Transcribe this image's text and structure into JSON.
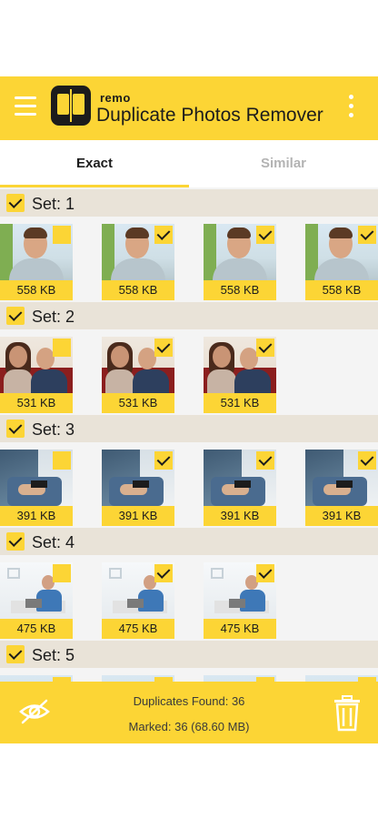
{
  "header": {
    "brand_sub": "remo",
    "title": "Duplicate Photos Remover",
    "colors": {
      "accent": "#fcd535",
      "dark": "#1c1c1c"
    }
  },
  "tabs": [
    {
      "label": "Exact",
      "active": true
    },
    {
      "label": "Similar",
      "active": false
    }
  ],
  "sets": [
    {
      "label": "Set: 1",
      "checked": true,
      "photo": "man-portrait",
      "items": [
        {
          "size": "558 KB",
          "checked": false
        },
        {
          "size": "558 KB",
          "checked": true
        },
        {
          "size": "558 KB",
          "checked": true
        },
        {
          "size": "558 KB",
          "checked": true
        }
      ]
    },
    {
      "label": "Set: 2",
      "checked": true,
      "photo": "couple-on-sofa",
      "items": [
        {
          "size": "531 KB",
          "checked": false
        },
        {
          "size": "531 KB",
          "checked": true
        },
        {
          "size": "531 KB",
          "checked": true
        }
      ]
    },
    {
      "label": "Set: 3",
      "checked": true,
      "photo": "hand-with-phone",
      "items": [
        {
          "size": "391 KB",
          "checked": false
        },
        {
          "size": "391 KB",
          "checked": true
        },
        {
          "size": "391 KB",
          "checked": true
        },
        {
          "size": "391 KB",
          "checked": true
        }
      ]
    },
    {
      "label": "Set: 4",
      "checked": true,
      "photo": "man-with-laptop",
      "items": [
        {
          "size": "475 KB",
          "checked": false
        },
        {
          "size": "475 KB",
          "checked": true
        },
        {
          "size": "475 KB",
          "checked": true
        }
      ]
    },
    {
      "label": "Set: 5",
      "checked": true
    }
  ],
  "footer": {
    "duplicates_found": "Duplicates Found: 36",
    "marked": "Marked: 36 (68.60 MB)",
    "left_icon": "eye-off-icon",
    "right_icon": "trash-icon"
  }
}
